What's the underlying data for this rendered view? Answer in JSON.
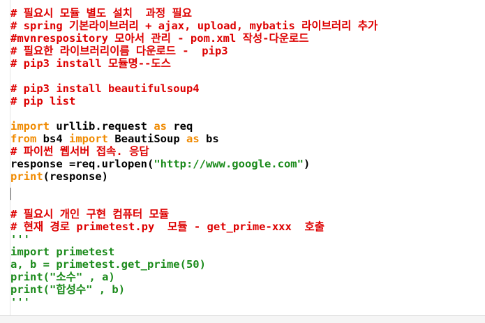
{
  "editor": {
    "lines": [
      {
        "segments": [
          {
            "t": "# 필요시 모듈 별도 설치  과정 필요",
            "c": "cm"
          }
        ]
      },
      {
        "segments": [
          {
            "t": "# spring 기본라이브러리 + ajax, upload, mybatis 라이브러리 추가",
            "c": "cm"
          }
        ]
      },
      {
        "segments": [
          {
            "t": "#mvnrespository 모아서 관리 - pom.xml 작성-다운로드",
            "c": "cm"
          }
        ]
      },
      {
        "segments": [
          {
            "t": "# 필요한 라이브러리이름 다운로드 -  pip3",
            "c": "cm"
          }
        ]
      },
      {
        "segments": [
          {
            "t": "# pip3 install 모듈명--도스",
            "c": "cm"
          }
        ]
      },
      {
        "segments": []
      },
      {
        "segments": [
          {
            "t": "# pip3 install beautifulsoup4",
            "c": "cm"
          }
        ]
      },
      {
        "segments": [
          {
            "t": "# pip list",
            "c": "cm"
          }
        ]
      },
      {
        "segments": []
      },
      {
        "segments": [
          {
            "t": "import",
            "c": "kw"
          },
          {
            "t": " urllib.request ",
            "c": ""
          },
          {
            "t": "as",
            "c": "kw"
          },
          {
            "t": " req",
            "c": ""
          }
        ]
      },
      {
        "segments": [
          {
            "t": "from",
            "c": "kw"
          },
          {
            "t": " bs4 ",
            "c": ""
          },
          {
            "t": "import",
            "c": "kw"
          },
          {
            "t": " BeautiSoup ",
            "c": ""
          },
          {
            "t": "as",
            "c": "kw"
          },
          {
            "t": " bs",
            "c": ""
          }
        ]
      },
      {
        "segments": [
          {
            "t": "# 파이썬 웹서버 접속. 응답",
            "c": "cm"
          }
        ]
      },
      {
        "segments": [
          {
            "t": "response =req.urlopen(",
            "c": ""
          },
          {
            "t": "\"http://www.google.com\"",
            "c": "st"
          },
          {
            "t": ")",
            "c": ""
          }
        ]
      },
      {
        "segments": [
          {
            "t": "print",
            "c": "kw"
          },
          {
            "t": "(response)",
            "c": ""
          }
        ]
      },
      {
        "segments": []
      },
      {
        "segments": []
      },
      {
        "segments": [
          {
            "t": "# 필요시 개인 구현 컴퓨터 모듈",
            "c": "cm"
          }
        ]
      },
      {
        "segments": [
          {
            "t": "# 현재 경로 primetest.py  모듈 - get_prime-xxx  호출",
            "c": "cm"
          }
        ]
      },
      {
        "segments": [
          {
            "t": "'''",
            "c": "st"
          }
        ]
      },
      {
        "segments": [
          {
            "t": "import primetest",
            "c": "st"
          }
        ]
      },
      {
        "segments": [
          {
            "t": "a, b = primetest.get_prime(50)",
            "c": "st"
          }
        ]
      },
      {
        "segments": [
          {
            "t": "print(\"소수\" , a)",
            "c": "st"
          }
        ]
      },
      {
        "segments": [
          {
            "t": "print(\"합성수\" , b)",
            "c": "st"
          }
        ]
      },
      {
        "segments": [
          {
            "t": "'''",
            "c": "st"
          }
        ]
      }
    ]
  }
}
